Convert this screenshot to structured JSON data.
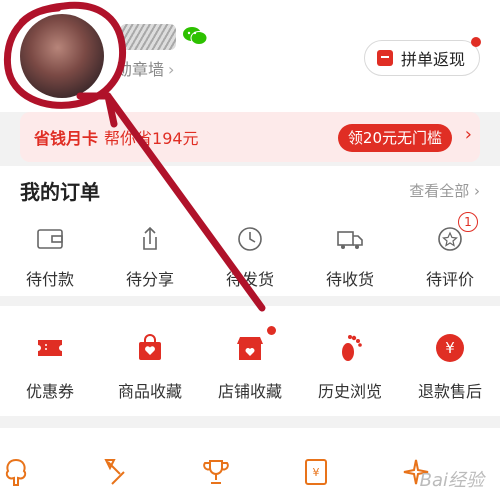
{
  "header": {
    "badge_wall": "勋章墙",
    "group_button": "拼单返现"
  },
  "promo": {
    "title": "省钱月卡",
    "subtitle": "帮你省194元",
    "cta": "领20元无门槛"
  },
  "orders": {
    "title": "我的订单",
    "view_all": "查看全部",
    "items": [
      {
        "label": "待付款",
        "icon": "wallet-icon"
      },
      {
        "label": "待分享",
        "icon": "share-icon"
      },
      {
        "label": "待发货",
        "icon": "clock-icon"
      },
      {
        "label": "待收货",
        "icon": "truck-icon"
      },
      {
        "label": "待评价",
        "icon": "rating-icon",
        "badge": "1"
      }
    ]
  },
  "services": {
    "items": [
      {
        "label": "优惠券",
        "icon": "coupon-icon"
      },
      {
        "label": "商品收藏",
        "icon": "favorite-bag-icon"
      },
      {
        "label": "店铺收藏",
        "icon": "store-favorite-icon"
      },
      {
        "label": "历史浏览",
        "icon": "footprint-icon"
      },
      {
        "label": "退款售后",
        "icon": "refund-icon"
      }
    ]
  },
  "bottom_icons": [
    "tree-icon",
    "axe-icon",
    "trophy-icon",
    "red-envelope-icon",
    "sparkle-icon"
  ],
  "colors": {
    "brand_red": "#e02e24",
    "annotation_red": "#b0122a",
    "promo_bg": "#fdeaea"
  },
  "watermark": "Bai经验"
}
